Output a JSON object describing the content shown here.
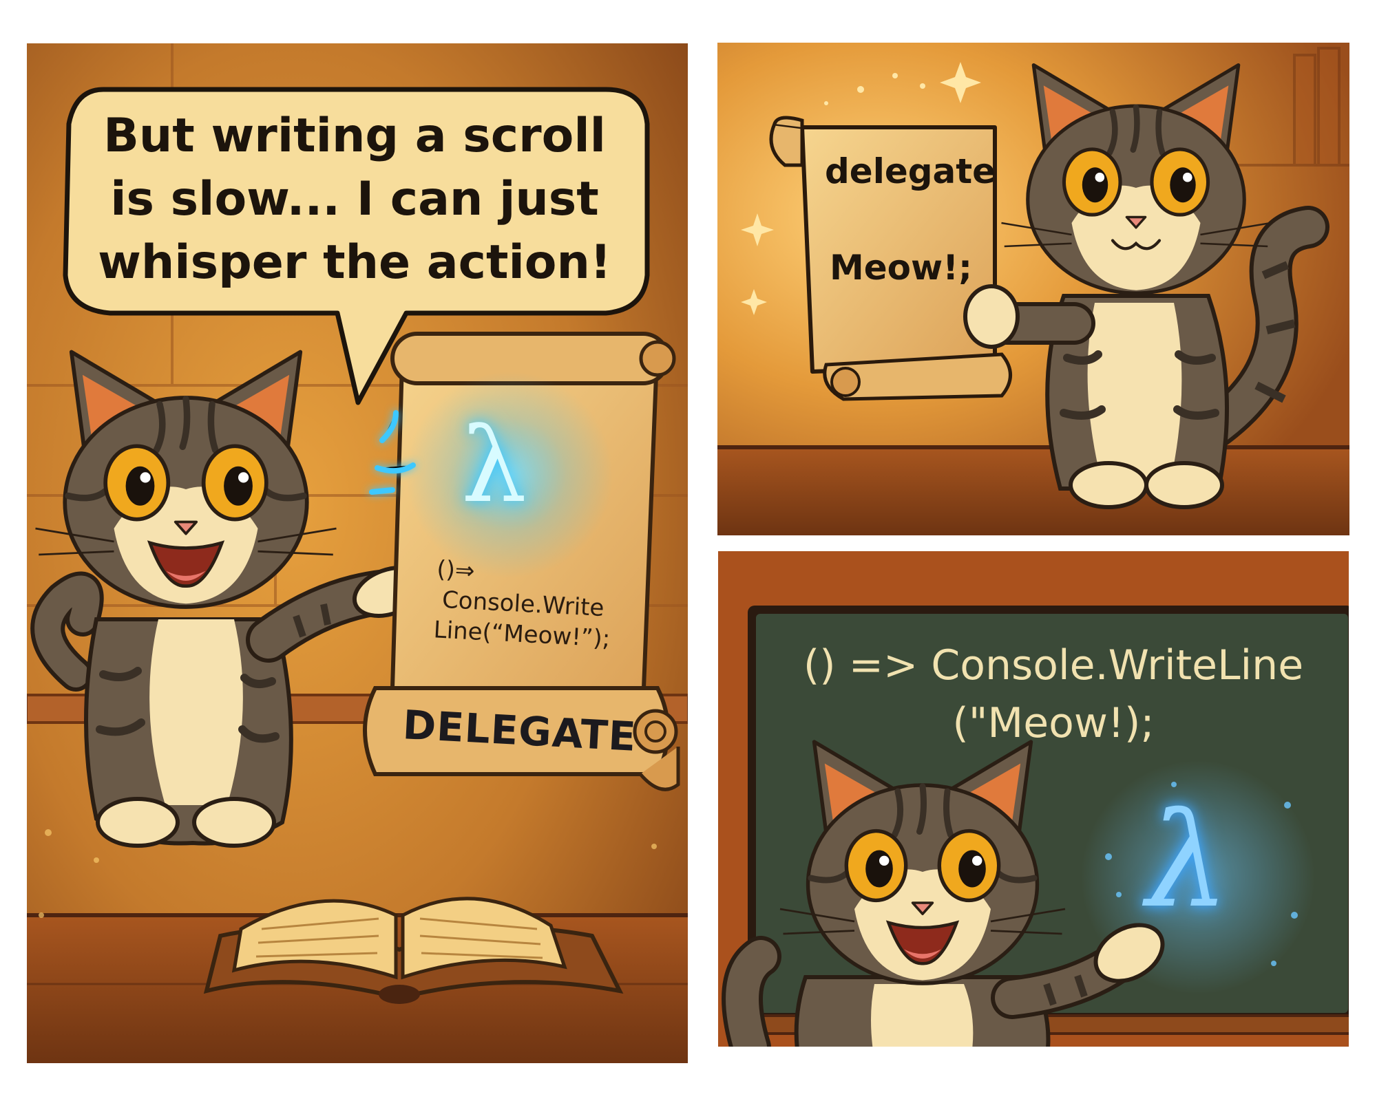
{
  "panel1": {
    "speech_lines": [
      "But writing a scroll",
      "is slow... I can just",
      "whisper the action!"
    ],
    "scroll_symbol": "λ",
    "scroll_code_lines": [
      "()⇒",
      "Console.Write",
      "Line(“Meow!”);"
    ],
    "banner_label": "DELEGATE"
  },
  "panel2": {
    "scroll_title": "delegate",
    "scroll_body": "Meow!;"
  },
  "panel3": {
    "board_lines": [
      "() => Console.WriteLine",
      "(\"Meow!);"
    ],
    "symbol": "λ"
  },
  "colors": {
    "wood_warm": "#c9792a",
    "wood_dark": "#7a3b14",
    "parchment": "#f3cf84",
    "chalkboard": "#3b4a38",
    "glow_blue": "#3ec8ff",
    "cat_fur": "#6a5a48",
    "cat_stripe": "#3a3026",
    "cat_cream": "#f6e2b0",
    "eye": "#f0a81e"
  }
}
